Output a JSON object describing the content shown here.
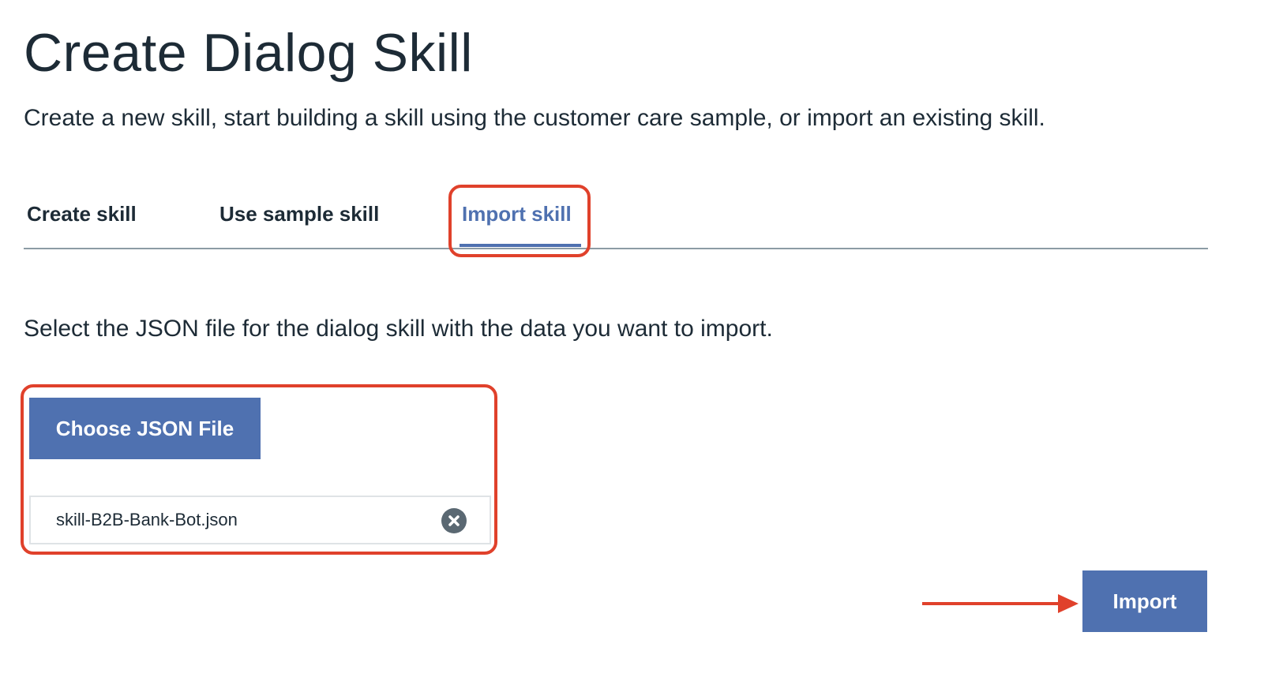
{
  "page": {
    "title": "Create Dialog Skill",
    "subtitle": "Create a new skill, start building a skill using the customer care sample, or import an existing skill."
  },
  "tabs": [
    {
      "label": "Create skill",
      "active": false
    },
    {
      "label": "Use sample skill",
      "active": false
    },
    {
      "label": "Import skill",
      "active": true
    }
  ],
  "import": {
    "instruction": "Select the JSON file for the dialog skill with the data you want to import.",
    "choose_button_label": "Choose JSON File",
    "selected_file": "skill-B2B-Bank-Bot.json",
    "clear_icon": "close-circle-icon",
    "submit_label": "Import"
  },
  "colors": {
    "accent": "#4f71b0",
    "annotation": "#e0412b",
    "text": "#1d2b36"
  }
}
